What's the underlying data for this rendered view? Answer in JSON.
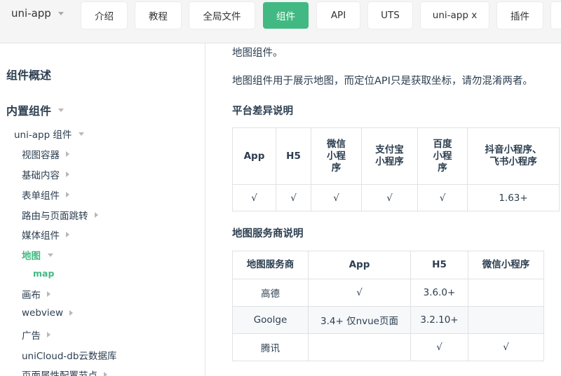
{
  "brand": {
    "label": "uni-app"
  },
  "nav": [
    {
      "label": "介绍"
    },
    {
      "label": "教程"
    },
    {
      "label": "全局文件"
    },
    {
      "label": "组件",
      "active": true
    },
    {
      "label": "API"
    },
    {
      "label": "UTS"
    },
    {
      "label": "uni-app x"
    },
    {
      "label": "插件"
    }
  ],
  "sidebar": {
    "overview": "组件概述",
    "builtin": "内置组件",
    "uniapp_components": "uni-app 组件",
    "items": [
      "视图容器",
      "基础内容",
      "表单组件",
      "路由与页面跳转",
      "媒体组件",
      "地图",
      "画布",
      "webview",
      "广告",
      "uniCloud-db云数据库",
      "页面属性配置节点"
    ],
    "map_child": "map"
  },
  "content": {
    "intro": "地图组件。",
    "desc": "地图组件用于展示地图，而定位API只是获取坐标，请勿混淆两者。",
    "platform_heading": "平台差异说明",
    "platform_table": {
      "headers": [
        "App",
        "H5",
        "微信\n小程\n序",
        "支付宝\n小程序",
        "百度\n小程\n序",
        "抖音小程序、\n飞书小程序"
      ],
      "row": [
        "√",
        "√",
        "√",
        "√",
        "√",
        "1.63+"
      ]
    },
    "provider_heading": "地图服务商说明",
    "provider_table": {
      "headers": [
        "地图服务商",
        "App",
        "H5",
        "微信小程序"
      ],
      "rows": [
        [
          "高德",
          "√",
          "3.6.0+",
          ""
        ],
        [
          "Goolge",
          "3.4+ 仅nvue页面",
          "3.2.10+",
          ""
        ],
        [
          "腾讯",
          "",
          "√",
          "√"
        ]
      ]
    }
  },
  "colors": {
    "accent": "#42b983",
    "text": "#2c3e50",
    "border": "#dfe2e5"
  }
}
